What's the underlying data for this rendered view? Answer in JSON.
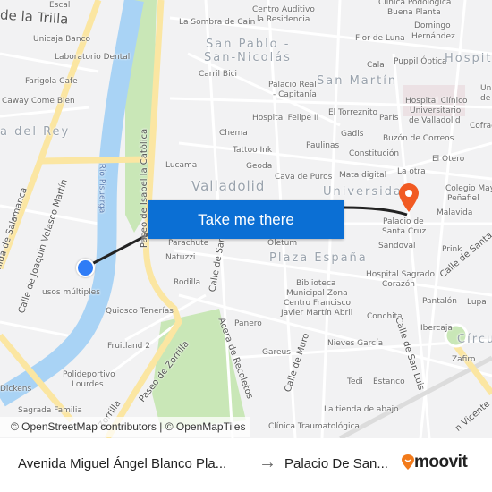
{
  "map": {
    "labels": [
      "Escal",
      "de la Trilla",
      "Unicaja Banco",
      "Laboratorio Dental",
      "Farigola Cafe",
      "Caway Come Bien",
      "a del Rey",
      "Río Pisuerga",
      "Paseo de Isabel la Católica",
      "Lucama",
      "Valladolid",
      "La Sombra de Caín",
      "San Pablo -",
      "San-Nicolás",
      "Carril Bici",
      "Chema",
      "Tattoo Ink",
      "Centro Auditivo",
      "la Residencia",
      "Clínica Podológica",
      "Buena Planta",
      "Domingo",
      "Hernández",
      "Flor de Luna",
      "Cala",
      "Puppil Óptica",
      "Hospita",
      "San Martín",
      "Palacio Real",
      "- Capitanía",
      "Hospital Felipe II",
      "El Torreznito",
      "París",
      "Hospital Clínico",
      "Universitario",
      "de Valladolid",
      "Gadis",
      "Buzón de Correos",
      "Paulinas",
      "Constitución",
      "El Otero",
      "Geoda",
      "Cava de Puros",
      "Mata digital",
      "La otra",
      "Universidad",
      "Colegio Mayor",
      "Peñafiel",
      "Malavida",
      "Cofrad",
      "Palacio de",
      "Santa Cruz",
      "Sandoval",
      "Prink",
      "Calle de Santa",
      "Parachute",
      "Natuzzi",
      "Rodilla",
      "Calle de San",
      "Oletum",
      "Plaza España",
      "Biblioteca",
      "Municipal Zona",
      "Centro Francisco",
      "Javier Martín Abril",
      "Hospital Sagrado",
      "Corazón",
      "Pantalón",
      "Lupa",
      "Conchita",
      "Calle de San Luis",
      "Ibercaja",
      "Círcul",
      "Zafiro",
      "Panero",
      "Nieves García",
      "Gareus",
      "Calle de Muro",
      "Tedi",
      "Estanco",
      "La tienda de abajo",
      "Clínica Traumatológica",
      "n Vicente",
      "Acera de Recoletos",
      "Paseo de Zorrilla",
      "Zorrilla",
      "Quiosco Tenerías",
      "usos múltiples",
      "Fruitland 2",
      "Polideportivo",
      "Lourdes",
      "Dickens",
      "Sagrada Familia",
      "Calle de Joaquín Velasco Martín",
      "nida de Salamanca",
      "Uni",
      "de V"
    ],
    "cta_label": "Take me there",
    "attribution": "© OpenStreetMap contributors | © OpenMapTiles",
    "colors": {
      "origin_marker": "#2f7cf6",
      "destination_marker": "#f15a22",
      "button": "#0b6fd4",
      "route": "#222222"
    }
  },
  "footer": {
    "origin": "Avenida Miguel Ángel Blanco Pla...",
    "arrow": "→",
    "destination": "Palacio De San...",
    "logo": "moovit"
  }
}
